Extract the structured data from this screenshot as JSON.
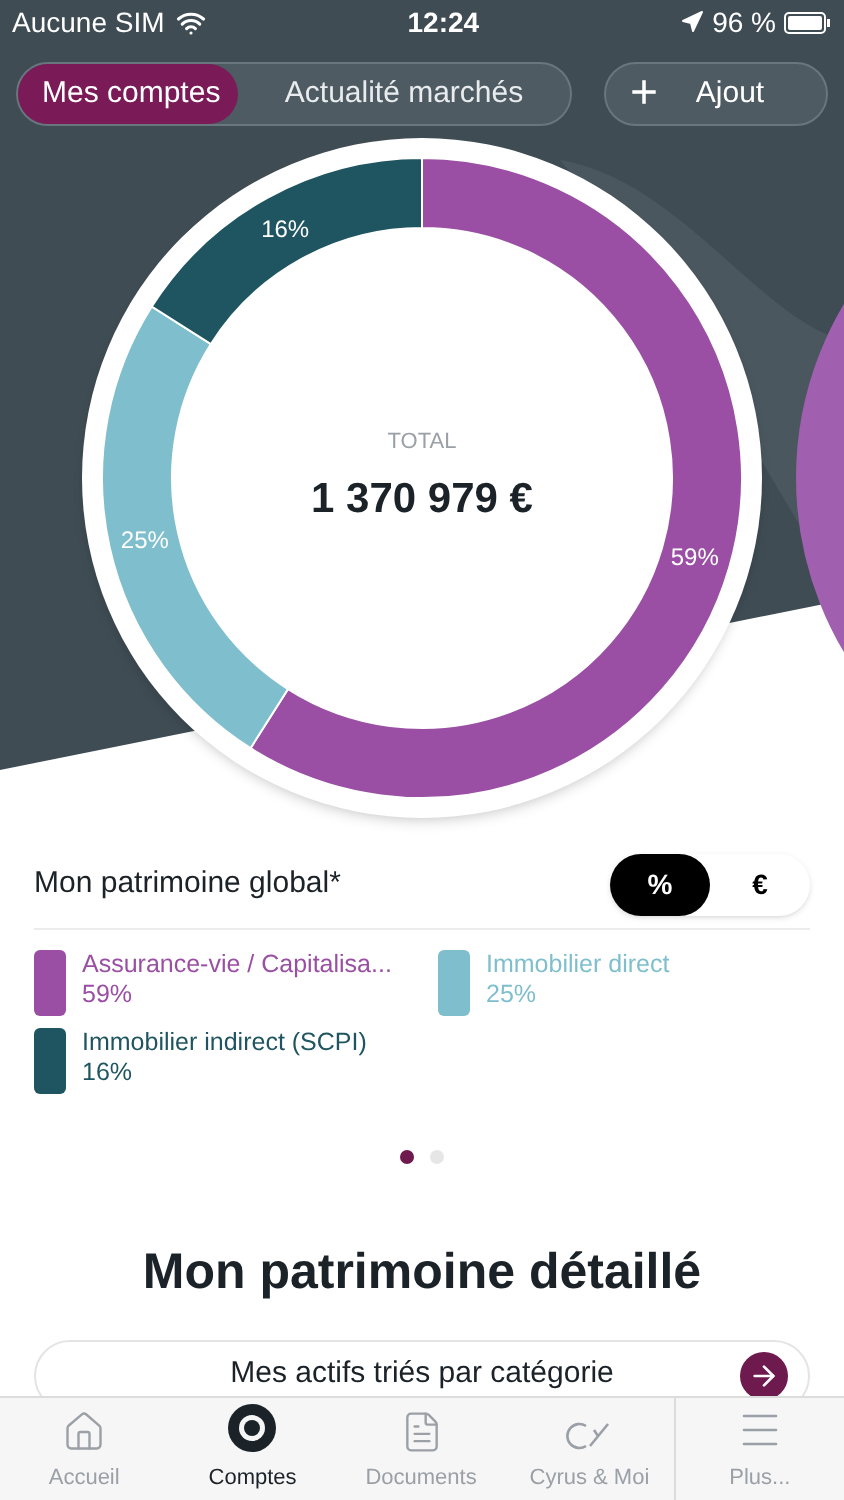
{
  "status_bar": {
    "carrier": "Aucune SIM",
    "time": "12:24",
    "battery": "96 %"
  },
  "top_tabs": [
    {
      "label": "Mes comptes",
      "selected": true
    },
    {
      "label": "Actualité marchés",
      "selected": false
    }
  ],
  "add_button": {
    "icon": "+",
    "label": "Ajout"
  },
  "chart": {
    "total_label": "TOTAL",
    "total_value": "1 370 979 €",
    "chart_data": {
      "type": "donut",
      "values": [
        59,
        25,
        16
      ],
      "colors": [
        "#9a4fa4",
        "#7fbfcd",
        "#1f5560"
      ],
      "value_labels": [
        "59%",
        "25%",
        "16%"
      ]
    }
  },
  "summary": {
    "title": "Mon patrimoine global*",
    "units": [
      {
        "label": "%",
        "selected": true
      },
      {
        "label": "€",
        "selected": false
      }
    ],
    "legend": [
      {
        "label": "Assurance-vie / Capitalisa...",
        "value": "59%",
        "color": "#9a4fa4"
      },
      {
        "label": "Immobilier direct",
        "value": "25%",
        "color": "#7fbfcd"
      },
      {
        "label": "Immobilier indirect (SCPI)",
        "value": "16%",
        "color": "#1f5560"
      }
    ]
  },
  "pager": [
    {
      "selected": true
    },
    {
      "selected": false
    }
  ],
  "detail": {
    "title": "Mon patrimoine détaillé",
    "button": "Mes actifs triés par catégorie"
  },
  "tab_bar": [
    {
      "label": "Accueil",
      "kind": "home",
      "selected": false
    },
    {
      "label": "Comptes",
      "kind": "accounts",
      "selected": true
    },
    {
      "label": "Documents",
      "kind": "documents",
      "selected": false
    },
    {
      "label": "Cyrus & Moi",
      "kind": "logo",
      "selected": false
    },
    {
      "label": "Plus...",
      "kind": "more",
      "selected": false
    }
  ]
}
